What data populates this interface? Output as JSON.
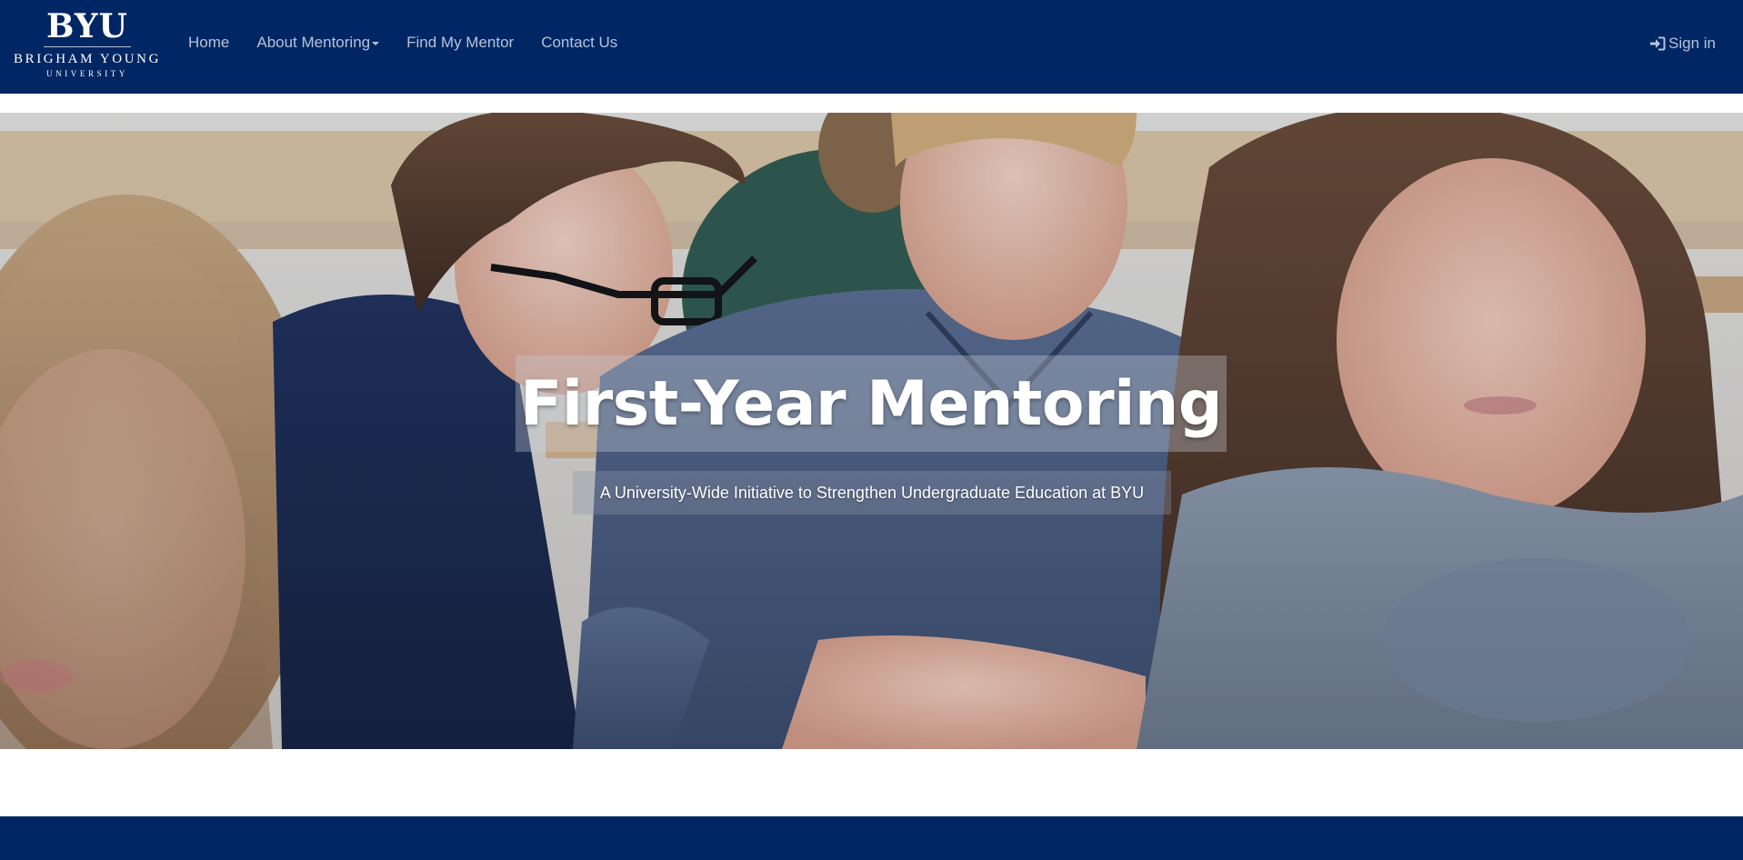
{
  "brand": {
    "wordmark": "BYU",
    "name_line1": "BRIGHAM YOUNG",
    "name_line2": "UNIVERSITY"
  },
  "nav": {
    "items": [
      {
        "label": "Home"
      },
      {
        "label": "About Mentoring",
        "has_dropdown": true
      },
      {
        "label": "Find My Mentor"
      },
      {
        "label": "Contact Us"
      }
    ],
    "signin_label": "Sign in",
    "signin_icon": "sign-in-icon"
  },
  "hero": {
    "title": "First-Year Mentoring",
    "subtitle": "A University-Wide Initiative to Strengthen Undergraduate Education at BYU"
  },
  "colors": {
    "brand_navy": "#002663",
    "nav_text": "#b5c3da",
    "white": "#ffffff"
  }
}
